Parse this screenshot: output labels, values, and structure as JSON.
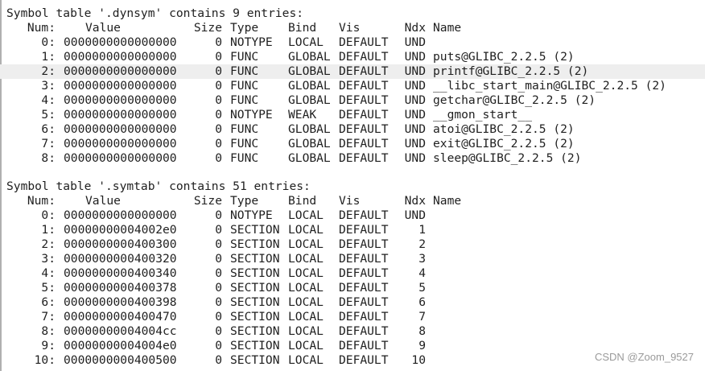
{
  "tables": [
    {
      "title": "Symbol table '.dynsym' contains 9 entries:",
      "headers": [
        "Num:",
        "Value",
        "Size",
        "Type",
        "Bind",
        "Vis",
        "Ndx",
        "Name"
      ],
      "rows": [
        [
          "0:",
          "0000000000000000",
          "0",
          "NOTYPE",
          "LOCAL",
          "DEFAULT",
          "UND",
          ""
        ],
        [
          "1:",
          "0000000000000000",
          "0",
          "FUNC",
          "GLOBAL",
          "DEFAULT",
          "UND",
          "puts@GLIBC_2.2.5 (2)"
        ],
        [
          "2:",
          "0000000000000000",
          "0",
          "FUNC",
          "GLOBAL",
          "DEFAULT",
          "UND",
          "printf@GLIBC_2.2.5 (2)"
        ],
        [
          "3:",
          "0000000000000000",
          "0",
          "FUNC",
          "GLOBAL",
          "DEFAULT",
          "UND",
          "__libc_start_main@GLIBC_2.2.5 (2)"
        ],
        [
          "4:",
          "0000000000000000",
          "0",
          "FUNC",
          "GLOBAL",
          "DEFAULT",
          "UND",
          "getchar@GLIBC_2.2.5 (2)"
        ],
        [
          "5:",
          "0000000000000000",
          "0",
          "NOTYPE",
          "WEAK",
          "DEFAULT",
          "UND",
          "__gmon_start__"
        ],
        [
          "6:",
          "0000000000000000",
          "0",
          "FUNC",
          "GLOBAL",
          "DEFAULT",
          "UND",
          "atoi@GLIBC_2.2.5 (2)"
        ],
        [
          "7:",
          "0000000000000000",
          "0",
          "FUNC",
          "GLOBAL",
          "DEFAULT",
          "UND",
          "exit@GLIBC_2.2.5 (2)"
        ],
        [
          "8:",
          "0000000000000000",
          "0",
          "FUNC",
          "GLOBAL",
          "DEFAULT",
          "UND",
          "sleep@GLIBC_2.2.5 (2)"
        ]
      ]
    },
    {
      "title": "Symbol table '.symtab' contains 51 entries:",
      "headers": [
        "Num:",
        "Value",
        "Size",
        "Type",
        "Bind",
        "Vis",
        "Ndx",
        "Name"
      ],
      "rows": [
        [
          "0:",
          "0000000000000000",
          "0",
          "NOTYPE",
          "LOCAL",
          "DEFAULT",
          "UND",
          ""
        ],
        [
          "1:",
          "00000000004002e0",
          "0",
          "SECTION",
          "LOCAL",
          "DEFAULT",
          "1",
          ""
        ],
        [
          "2:",
          "0000000000400300",
          "0",
          "SECTION",
          "LOCAL",
          "DEFAULT",
          "2",
          ""
        ],
        [
          "3:",
          "0000000000400320",
          "0",
          "SECTION",
          "LOCAL",
          "DEFAULT",
          "3",
          ""
        ],
        [
          "4:",
          "0000000000400340",
          "0",
          "SECTION",
          "LOCAL",
          "DEFAULT",
          "4",
          ""
        ],
        [
          "5:",
          "0000000000400378",
          "0",
          "SECTION",
          "LOCAL",
          "DEFAULT",
          "5",
          ""
        ],
        [
          "6:",
          "0000000000400398",
          "0",
          "SECTION",
          "LOCAL",
          "DEFAULT",
          "6",
          ""
        ],
        [
          "7:",
          "0000000000400470",
          "0",
          "SECTION",
          "LOCAL",
          "DEFAULT",
          "7",
          ""
        ],
        [
          "8:",
          "00000000004004cc",
          "0",
          "SECTION",
          "LOCAL",
          "DEFAULT",
          "8",
          ""
        ],
        [
          "9:",
          "00000000004004e0",
          "0",
          "SECTION",
          "LOCAL",
          "DEFAULT",
          "9",
          ""
        ],
        [
          "10:",
          "0000000000400500",
          "0",
          "SECTION",
          "LOCAL",
          "DEFAULT",
          "10",
          ""
        ]
      ]
    }
  ],
  "highlighted_row": {
    "table": 0,
    "row": 2
  },
  "watermark": "CSDN @Zoom_9527"
}
